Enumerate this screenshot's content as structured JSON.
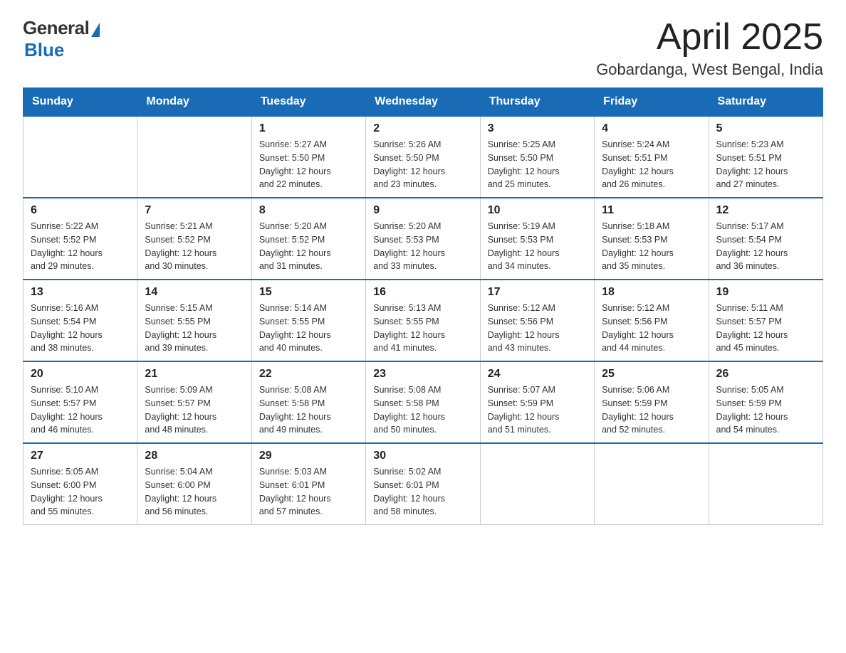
{
  "logo": {
    "general": "General",
    "blue": "Blue"
  },
  "title": "April 2025",
  "location": "Gobardanga, West Bengal, India",
  "days_of_week": [
    "Sunday",
    "Monday",
    "Tuesday",
    "Wednesday",
    "Thursday",
    "Friday",
    "Saturday"
  ],
  "weeks": [
    [
      {
        "day": "",
        "info": ""
      },
      {
        "day": "",
        "info": ""
      },
      {
        "day": "1",
        "info": "Sunrise: 5:27 AM\nSunset: 5:50 PM\nDaylight: 12 hours\nand 22 minutes."
      },
      {
        "day": "2",
        "info": "Sunrise: 5:26 AM\nSunset: 5:50 PM\nDaylight: 12 hours\nand 23 minutes."
      },
      {
        "day": "3",
        "info": "Sunrise: 5:25 AM\nSunset: 5:50 PM\nDaylight: 12 hours\nand 25 minutes."
      },
      {
        "day": "4",
        "info": "Sunrise: 5:24 AM\nSunset: 5:51 PM\nDaylight: 12 hours\nand 26 minutes."
      },
      {
        "day": "5",
        "info": "Sunrise: 5:23 AM\nSunset: 5:51 PM\nDaylight: 12 hours\nand 27 minutes."
      }
    ],
    [
      {
        "day": "6",
        "info": "Sunrise: 5:22 AM\nSunset: 5:52 PM\nDaylight: 12 hours\nand 29 minutes."
      },
      {
        "day": "7",
        "info": "Sunrise: 5:21 AM\nSunset: 5:52 PM\nDaylight: 12 hours\nand 30 minutes."
      },
      {
        "day": "8",
        "info": "Sunrise: 5:20 AM\nSunset: 5:52 PM\nDaylight: 12 hours\nand 31 minutes."
      },
      {
        "day": "9",
        "info": "Sunrise: 5:20 AM\nSunset: 5:53 PM\nDaylight: 12 hours\nand 33 minutes."
      },
      {
        "day": "10",
        "info": "Sunrise: 5:19 AM\nSunset: 5:53 PM\nDaylight: 12 hours\nand 34 minutes."
      },
      {
        "day": "11",
        "info": "Sunrise: 5:18 AM\nSunset: 5:53 PM\nDaylight: 12 hours\nand 35 minutes."
      },
      {
        "day": "12",
        "info": "Sunrise: 5:17 AM\nSunset: 5:54 PM\nDaylight: 12 hours\nand 36 minutes."
      }
    ],
    [
      {
        "day": "13",
        "info": "Sunrise: 5:16 AM\nSunset: 5:54 PM\nDaylight: 12 hours\nand 38 minutes."
      },
      {
        "day": "14",
        "info": "Sunrise: 5:15 AM\nSunset: 5:55 PM\nDaylight: 12 hours\nand 39 minutes."
      },
      {
        "day": "15",
        "info": "Sunrise: 5:14 AM\nSunset: 5:55 PM\nDaylight: 12 hours\nand 40 minutes."
      },
      {
        "day": "16",
        "info": "Sunrise: 5:13 AM\nSunset: 5:55 PM\nDaylight: 12 hours\nand 41 minutes."
      },
      {
        "day": "17",
        "info": "Sunrise: 5:12 AM\nSunset: 5:56 PM\nDaylight: 12 hours\nand 43 minutes."
      },
      {
        "day": "18",
        "info": "Sunrise: 5:12 AM\nSunset: 5:56 PM\nDaylight: 12 hours\nand 44 minutes."
      },
      {
        "day": "19",
        "info": "Sunrise: 5:11 AM\nSunset: 5:57 PM\nDaylight: 12 hours\nand 45 minutes."
      }
    ],
    [
      {
        "day": "20",
        "info": "Sunrise: 5:10 AM\nSunset: 5:57 PM\nDaylight: 12 hours\nand 46 minutes."
      },
      {
        "day": "21",
        "info": "Sunrise: 5:09 AM\nSunset: 5:57 PM\nDaylight: 12 hours\nand 48 minutes."
      },
      {
        "day": "22",
        "info": "Sunrise: 5:08 AM\nSunset: 5:58 PM\nDaylight: 12 hours\nand 49 minutes."
      },
      {
        "day": "23",
        "info": "Sunrise: 5:08 AM\nSunset: 5:58 PM\nDaylight: 12 hours\nand 50 minutes."
      },
      {
        "day": "24",
        "info": "Sunrise: 5:07 AM\nSunset: 5:59 PM\nDaylight: 12 hours\nand 51 minutes."
      },
      {
        "day": "25",
        "info": "Sunrise: 5:06 AM\nSunset: 5:59 PM\nDaylight: 12 hours\nand 52 minutes."
      },
      {
        "day": "26",
        "info": "Sunrise: 5:05 AM\nSunset: 5:59 PM\nDaylight: 12 hours\nand 54 minutes."
      }
    ],
    [
      {
        "day": "27",
        "info": "Sunrise: 5:05 AM\nSunset: 6:00 PM\nDaylight: 12 hours\nand 55 minutes."
      },
      {
        "day": "28",
        "info": "Sunrise: 5:04 AM\nSunset: 6:00 PM\nDaylight: 12 hours\nand 56 minutes."
      },
      {
        "day": "29",
        "info": "Sunrise: 5:03 AM\nSunset: 6:01 PM\nDaylight: 12 hours\nand 57 minutes."
      },
      {
        "day": "30",
        "info": "Sunrise: 5:02 AM\nSunset: 6:01 PM\nDaylight: 12 hours\nand 58 minutes."
      },
      {
        "day": "",
        "info": ""
      },
      {
        "day": "",
        "info": ""
      },
      {
        "day": "",
        "info": ""
      }
    ]
  ]
}
